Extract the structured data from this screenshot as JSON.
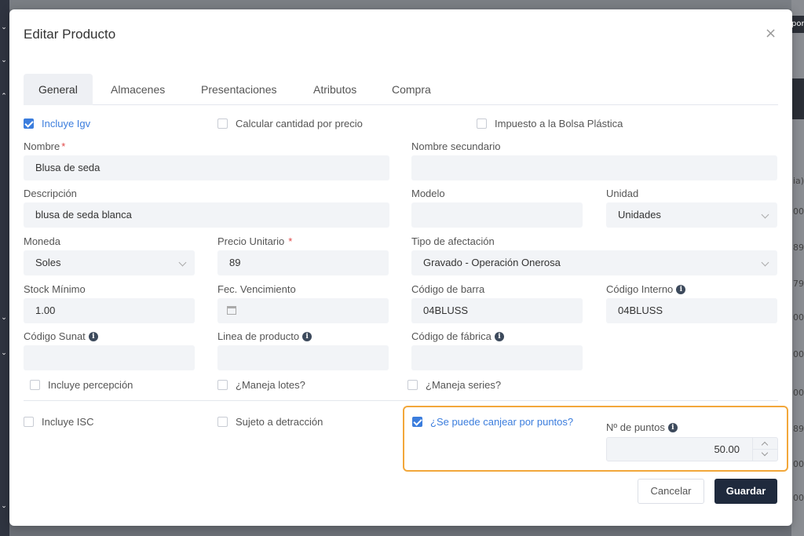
{
  "background": {
    "right_button_label": "por",
    "right_partial_values": [
      "ia)",
      "00",
      "89",
      "79",
      "00",
      "00",
      "00",
      "89",
      "00",
      "00",
      "00"
    ]
  },
  "modal": {
    "title": "Editar Producto",
    "close_icon": "×"
  },
  "tabs": [
    {
      "label": "General",
      "active": true
    },
    {
      "label": "Almacenes",
      "active": false
    },
    {
      "label": "Presentaciones",
      "active": false
    },
    {
      "label": "Atributos",
      "active": false
    },
    {
      "label": "Compra",
      "active": false
    }
  ],
  "checkboxes": {
    "incluye_igv": {
      "label": "Incluye Igv",
      "checked": true
    },
    "calcular_cantidad": {
      "label": "Calcular cantidad por precio",
      "checked": false
    },
    "impuesto_bolsa": {
      "label": "Impuesto a la Bolsa Plástica",
      "checked": false
    },
    "incluye_percepcion": {
      "label": "Incluye percepción",
      "checked": false
    },
    "maneja_lotes": {
      "label": "¿Maneja lotes?",
      "checked": false
    },
    "maneja_series": {
      "label": "¿Maneja series?",
      "checked": false
    },
    "incluye_isc": {
      "label": "Incluye ISC",
      "checked": false
    },
    "sujeto_detraccion": {
      "label": "Sujeto a detracción",
      "checked": false
    },
    "canjear_puntos": {
      "label": "¿Se puede canjear por puntos?",
      "checked": true
    }
  },
  "fields": {
    "nombre": {
      "label": "Nombre",
      "required": "*",
      "value": "Blusa de seda"
    },
    "nombre_secundario": {
      "label": "Nombre secundario",
      "value": ""
    },
    "descripcion": {
      "label": "Descripción",
      "value": "blusa de seda blanca"
    },
    "modelo": {
      "label": "Modelo",
      "value": ""
    },
    "unidad": {
      "label": "Unidad",
      "value": "Unidades"
    },
    "moneda": {
      "label": "Moneda",
      "value": "Soles"
    },
    "precio_unitario": {
      "label": "Precio Unitario",
      "required": "*",
      "value": "89"
    },
    "tipo_afectacion": {
      "label": "Tipo de afectación",
      "value": "Gravado - Operación Onerosa"
    },
    "stock_minimo": {
      "label": "Stock Mínimo",
      "value": "1.00"
    },
    "fec_vencimiento": {
      "label": "Fec. Vencimiento",
      "value": ""
    },
    "codigo_barra": {
      "label": "Código de barra",
      "value": "04BLUSS"
    },
    "codigo_interno": {
      "label": "Código Interno",
      "value": "04BLUSS"
    },
    "codigo_sunat": {
      "label": "Código Sunat",
      "value": ""
    },
    "linea_producto": {
      "label": "Linea de producto",
      "value": ""
    },
    "codigo_fabrica": {
      "label": "Código de fábrica",
      "value": ""
    },
    "num_puntos": {
      "label": "Nº de puntos",
      "value": "50.00"
    }
  },
  "buttons": {
    "cancel": "Cancelar",
    "save": "Guardar"
  },
  "colors": {
    "accent": "#3b7ddd",
    "highlight_border": "#f2a73a",
    "primary_button": "#1f2a3d",
    "required": "#e04848"
  }
}
